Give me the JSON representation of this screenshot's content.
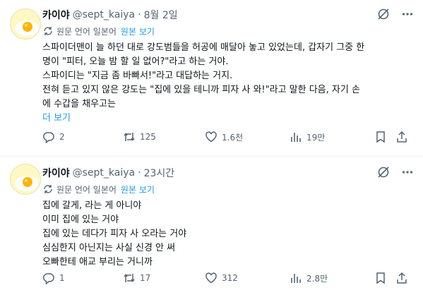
{
  "posts": [
    {
      "name": "카이야",
      "handle": "@sept_kaiya",
      "separator": "·",
      "time": "8월 2일",
      "translate": {
        "label": "원문 언어 일본어",
        "show_original": "원본 보기"
      },
      "lines": [
        "스파이더맨이 늘 하던 대로 강도범들을 허공에 매달아 놓고 있었는데, 갑자기 그중 한",
        "명이 \"피터, 오늘 밤 할 일 없어?\"라고 하는 거야.",
        "스파이디는 \"지금 좀 바빠서!\"라고 대답하는 거지.",
        "전혀 듣고 있지 않은 강도는 \"집에 있을 테니까 피자 사 와!\"라고 말한 다음, 자기 손",
        "에 수갑을 채우고는"
      ],
      "show_more": "더 보기",
      "stats": {
        "replies": "2",
        "reposts": "125",
        "likes": "1.6천",
        "views": "19만"
      }
    },
    {
      "name": "카이야",
      "handle": "@sept_kaiya",
      "separator": "·",
      "time": "23시간",
      "translate": {
        "label": "원문 언어 일본어",
        "show_original": "원본 보기"
      },
      "lines": [
        "집에 갈게, 라는 게 아니야",
        "이미 집에 있는 거야",
        "집에 있는 데다가 피자 사 오라는 거야",
        "심심한지 아닌지는 사실 신경 안 써",
        "오빠한테 애교 부리는 거니까"
      ],
      "stats": {
        "replies": "1",
        "reposts": "17",
        "likes": "312",
        "views": "2.8만"
      }
    }
  ],
  "colors": {
    "text": "#0f1419",
    "secondary": "#536471",
    "link": "#1d9bf0"
  },
  "icons": [
    "avatar-egg",
    "grok-icon",
    "more-icon",
    "translate-icon",
    "reply-icon",
    "repost-icon",
    "like-icon",
    "views-icon",
    "bookmark-icon",
    "share-icon"
  ]
}
